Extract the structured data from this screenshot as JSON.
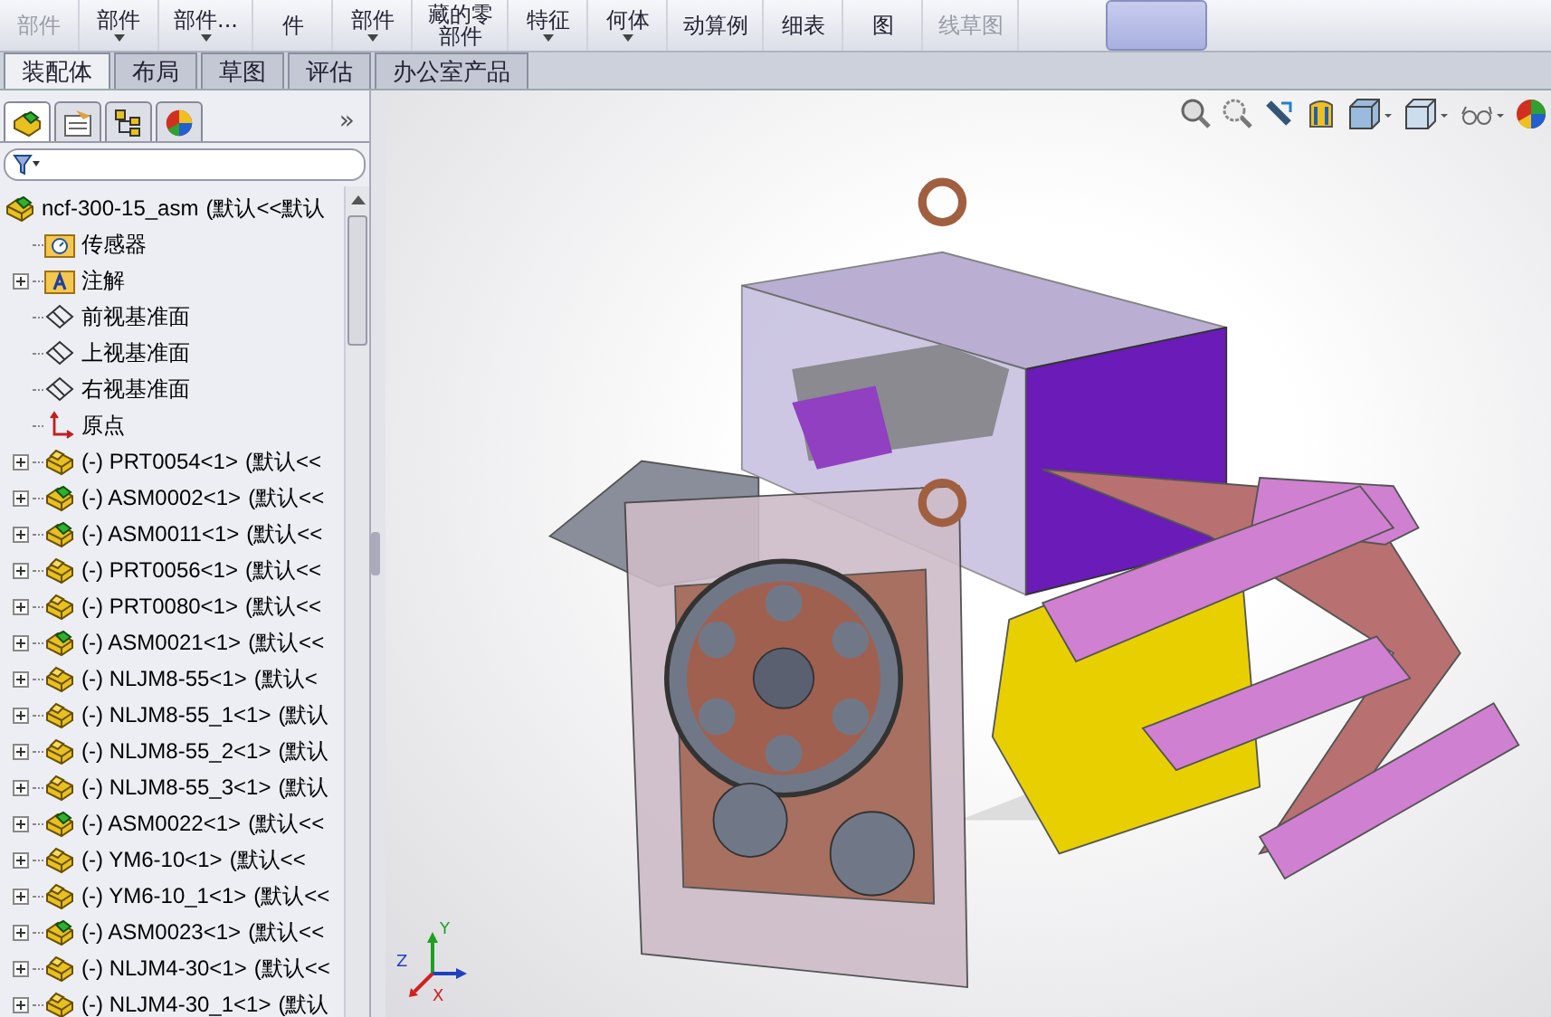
{
  "ribbon": {
    "items": [
      {
        "lines": [
          "部件"
        ],
        "disabled": true,
        "caret": false
      },
      {
        "lines": [
          "部件"
        ],
        "disabled": false,
        "caret": true
      },
      {
        "lines": [
          "部件..."
        ],
        "disabled": false,
        "caret": true
      },
      {
        "lines": [
          "件"
        ],
        "disabled": false,
        "caret": false
      },
      {
        "lines": [
          "部件"
        ],
        "disabled": false,
        "caret": true
      },
      {
        "lines": [
          "藏的零",
          "部件"
        ],
        "disabled": false,
        "caret": false
      },
      {
        "lines": [
          "特征"
        ],
        "disabled": false,
        "caret": true
      },
      {
        "lines": [
          "何体"
        ],
        "disabled": false,
        "caret": true
      },
      {
        "lines": [
          "动算例"
        ],
        "disabled": false,
        "caret": false
      },
      {
        "lines": [
          "细表"
        ],
        "disabled": false,
        "caret": false
      },
      {
        "lines": [
          "图"
        ],
        "disabled": false,
        "caret": false
      },
      {
        "lines": [
          "线草图"
        ],
        "disabled": true,
        "caret": false
      }
    ],
    "highlighted_button": true
  },
  "tabs": [
    {
      "label": "装配体",
      "selected": true
    },
    {
      "label": "布局",
      "selected": false
    },
    {
      "label": "草图",
      "selected": false
    },
    {
      "label": "评估",
      "selected": false
    },
    {
      "label": "办公室产品",
      "selected": false
    }
  ],
  "panel_tabs": [
    {
      "kind": "tree",
      "selected": true
    },
    {
      "kind": "property",
      "selected": false
    },
    {
      "kind": "config",
      "selected": false
    },
    {
      "kind": "appearance",
      "selected": false
    }
  ],
  "panel_more": "»",
  "tree": {
    "label": "ncf-300-15_asm",
    "config": "(默认<<默认",
    "kind": "assembly",
    "children": [
      {
        "label": "传感器",
        "kind": "sensors",
        "expandable": false
      },
      {
        "label": "注解",
        "kind": "annotations",
        "expandable": true
      },
      {
        "label": "前视基准面",
        "kind": "plane",
        "expandable": false
      },
      {
        "label": "上视基准面",
        "kind": "plane",
        "expandable": false
      },
      {
        "label": "右视基准面",
        "kind": "plane",
        "expandable": false
      },
      {
        "label": "原点",
        "kind": "origin",
        "expandable": false
      },
      {
        "label": "(-) PRT0054<1>",
        "config": "(默认<<",
        "kind": "part",
        "expandable": true
      },
      {
        "label": "(-) ASM0002<1>",
        "config": "(默认<<",
        "kind": "assembly",
        "expandable": true
      },
      {
        "label": "(-) ASM0011<1>",
        "config": "(默认<<",
        "kind": "assembly",
        "expandable": true
      },
      {
        "label": "(-) PRT0056<1>",
        "config": "(默认<<",
        "kind": "part",
        "expandable": true
      },
      {
        "label": "(-) PRT0080<1>",
        "config": "(默认<<",
        "kind": "part",
        "expandable": true
      },
      {
        "label": "(-) ASM0021<1>",
        "config": "(默认<<",
        "kind": "assembly",
        "expandable": true
      },
      {
        "label": "(-) NLJM8-55<1>",
        "config": "(默认<",
        "kind": "part",
        "expandable": true
      },
      {
        "label": "(-) NLJM8-55_1<1>",
        "config": "(默认",
        "kind": "part",
        "expandable": true
      },
      {
        "label": "(-) NLJM8-55_2<1>",
        "config": "(默认",
        "kind": "part",
        "expandable": true
      },
      {
        "label": "(-) NLJM8-55_3<1>",
        "config": "(默认",
        "kind": "part",
        "expandable": true
      },
      {
        "label": "(-) ASM0022<1>",
        "config": "(默认<<",
        "kind": "assembly",
        "expandable": true
      },
      {
        "label": "(-) YM6-10<1>",
        "config": "(默认<<",
        "kind": "part",
        "expandable": true
      },
      {
        "label": "(-) YM6-10_1<1>",
        "config": "(默认<<",
        "kind": "part",
        "expandable": true
      },
      {
        "label": "(-) ASM0023<1>",
        "config": "(默认<<",
        "kind": "assembly",
        "expandable": true
      },
      {
        "label": "(-) NLJM4-30<1>",
        "config": "(默认<<",
        "kind": "part",
        "expandable": true
      },
      {
        "label": "(-) NLJM4-30_1<1>",
        "config": "(默认",
        "kind": "part",
        "expandable": true
      }
    ]
  },
  "triad": {
    "x": "X",
    "y": "Y",
    "z": "Z"
  }
}
